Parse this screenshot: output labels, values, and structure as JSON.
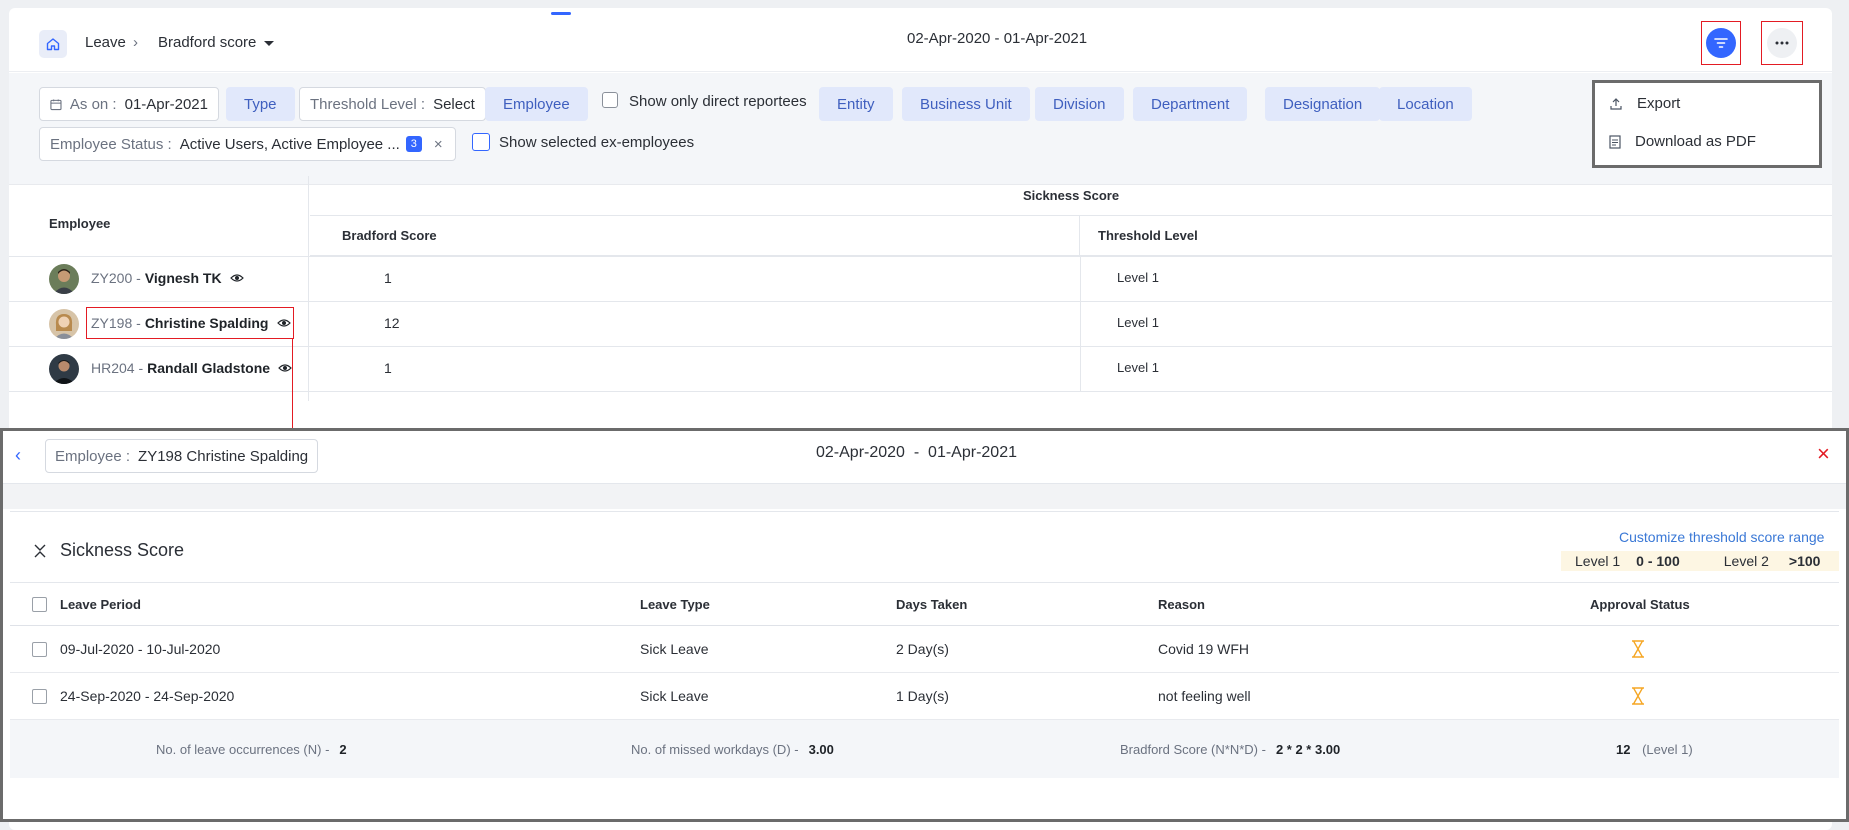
{
  "header": {
    "breadcrumb_root": "Leave",
    "breadcrumb_sep": "›",
    "breadcrumb_current": "Bradford score",
    "date_range": "02-Apr-2020 - 01-Apr-2021"
  },
  "filters": {
    "as_on_label": "As on :",
    "as_on_value": "01-Apr-2021",
    "type": "Type",
    "threshold_label": "Threshold Level :",
    "threshold_value": "Select",
    "employee": "Employee",
    "direct_reportees": "Show only direct reportees",
    "entity": "Entity",
    "business_unit": "Business Unit",
    "division": "Division",
    "department": "Department",
    "designation": "Designation",
    "location": "Location",
    "status_label": "Employee Status :",
    "status_value": "Active Users, Active Employee ...",
    "status_count": "3",
    "status_clear": "×",
    "ex_employees": "Show selected ex-employees"
  },
  "export_menu": {
    "export": "Export",
    "download_pdf": "Download as PDF"
  },
  "main_table": {
    "col_employee": "Employee",
    "group_header": "Sickness Score",
    "col_bradford": "Bradford Score",
    "col_threshold": "Threshold Level",
    "rows": [
      {
        "code": "ZY200 -",
        "name": "Vignesh TK",
        "score": "1",
        "level": "Level 1"
      },
      {
        "code": "ZY198 -",
        "name": "Christine Spalding",
        "score": "12",
        "level": "Level 1"
      },
      {
        "code": "HR204 -",
        "name": "Randall Gladstone",
        "score": "1",
        "level": "Level 1"
      }
    ]
  },
  "panel": {
    "back": "‹",
    "employee_label": "Employee :",
    "employee_value": "ZY198 Christine Spalding",
    "date_range": "02-Apr-2020  -  01-Apr-2021",
    "close": "×",
    "section_title": "Sickness Score",
    "customize_link": "Customize threshold score range",
    "level1_label": "Level 1",
    "level1_range": "0 - 100",
    "level2_label": "Level 2",
    "level2_range": ">100",
    "columns": {
      "leave_period": "Leave Period",
      "leave_type": "Leave Type",
      "days_taken": "Days Taken",
      "reason": "Reason",
      "approval_status": "Approval Status"
    },
    "rows": [
      {
        "period": "09-Jul-2020 - 10-Jul-2020",
        "type": "Sick Leave",
        "days": "2 Day(s)",
        "reason": "Covid 19 WFH"
      },
      {
        "period": "24-Sep-2020 - 24-Sep-2020",
        "type": "Sick Leave",
        "days": "1 Day(s)",
        "reason": "not feeling well"
      }
    ],
    "summary": {
      "occurrences_label": "No. of leave occurrences (N) -",
      "occurrences_value": "2",
      "missed_label": "No. of missed workdays (D) -",
      "missed_value": "3.00",
      "bradford_label": "Bradford Score (N*N*D) -",
      "bradford_formula": "2 * 2 * 3.00",
      "bradford_result": "12",
      "bradford_level": "(Level 1)"
    }
  },
  "colors": {
    "accent": "#3366ff",
    "highlight_red": "#e31b23",
    "pending_orange": "#f5a623"
  }
}
